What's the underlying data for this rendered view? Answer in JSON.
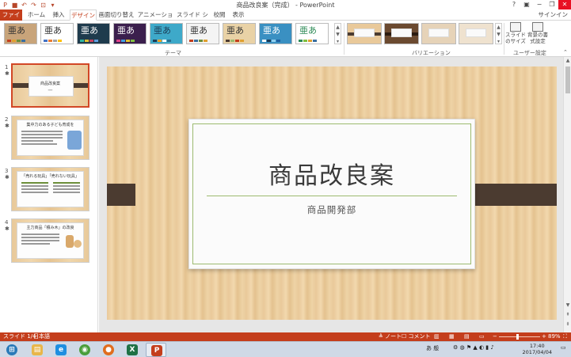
{
  "window": {
    "title": "商品改良案（完成） - PowerPoint",
    "help": "?",
    "minimize": "−",
    "restore": "❐",
    "close": "✕"
  },
  "qat": {
    "save": "■",
    "undo": "↶",
    "redo": "↷",
    "start": "⊡",
    "more": "▾"
  },
  "tabs": [
    "ファイル",
    "ホーム",
    "挿入",
    "デザイン",
    "画面切り替え",
    "アニメーション",
    "スライド ショー",
    "校閲",
    "表示"
  ],
  "active_tab": "デザイン",
  "signin": "サインイン",
  "ribbon": {
    "themes_label": "テーマ",
    "variations_label": "バリエーション",
    "user_settings_label": "ユーザー設定",
    "theme_glyph": "亜あ",
    "gallery_up": "▲",
    "gallery_down": "▼",
    "gallery_more": "▾",
    "themes": [
      {
        "bg": "#c8a47a",
        "fg": "#333333"
      },
      {
        "bg": "#ffffff",
        "fg": "#333333"
      },
      {
        "bg": "#1f3b4d",
        "fg": "#ffffff"
      },
      {
        "bg": "#3b1f4d",
        "fg": "#ffffff"
      },
      {
        "bg": "#3ea9c9",
        "fg": "#1b3b55"
      },
      {
        "bg": "#f4f4f4",
        "fg": "#333333"
      },
      {
        "bg": "#e9d2a6",
        "fg": "#333333"
      },
      {
        "bg": "#3a90c2",
        "fg": "#ffffff"
      },
      {
        "bg": "#ffffff",
        "fg": "#2e8b57"
      }
    ],
    "slide_size": "スライドのサイズ",
    "bg_format": "背景の書式設定",
    "collapse": "⌃"
  },
  "slides": [
    {
      "num": "1",
      "star": "✱",
      "title": "商品改良案"
    },
    {
      "num": "2",
      "star": "✱",
      "title": "集中力のある子ども育成を"
    },
    {
      "num": "3",
      "star": "✱",
      "title": "「売れる玩具」「売れない玩具」"
    },
    {
      "num": "4",
      "star": "✱",
      "title": "主力商品「積み木」の改良"
    }
  ],
  "main_slide": {
    "title": "商品改良案",
    "subtitle": "商品開発部"
  },
  "statusbar": {
    "slide_info": "スライド 1/4",
    "language": "日本語",
    "notes": "≜ ノート",
    "comments": "☐ コメント",
    "zoom_minus": "−",
    "zoom_plus": "+",
    "zoom_value": "89%",
    "zoom_level": 0.45
  },
  "taskbar": {
    "apps": [
      {
        "name": "explorer",
        "glyph": "▤",
        "color": "#e8b64a"
      },
      {
        "name": "ie",
        "glyph": "e",
        "color": "#1f8fe0"
      },
      {
        "name": "chrome",
        "glyph": "◉",
        "color": "#4a9e3a"
      },
      {
        "name": "firefox",
        "glyph": "●",
        "color": "#e06d1f"
      },
      {
        "name": "excel",
        "glyph": "X",
        "color": "#1e7145"
      },
      {
        "name": "powerpoint",
        "glyph": "P",
        "color": "#c43e1c"
      }
    ],
    "ime": "あ 般",
    "time": "17:40",
    "date": "2017/04/04"
  }
}
